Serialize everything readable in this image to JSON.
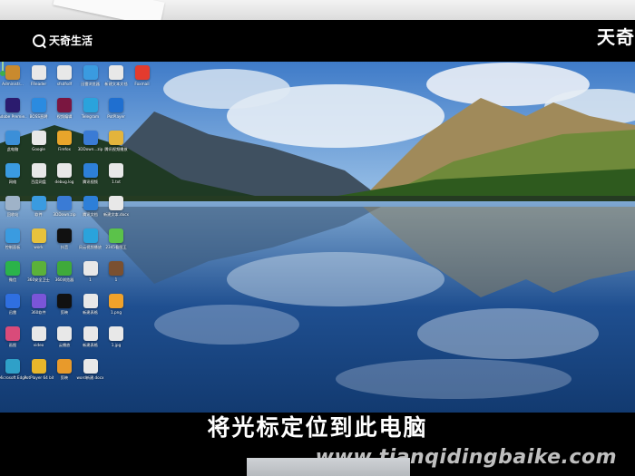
{
  "brand": {
    "left_logo_text": "天奇生活",
    "right_logo_text": "天奇"
  },
  "caption": "将光标定位到此电脑",
  "watermark": "www.tianqidingbaike.com",
  "desktop": {
    "icons": [
      {
        "label": "Administr...",
        "color": "#c98a2e",
        "icon": "user-folder-icon",
        "col": 0,
        "row": 0
      },
      {
        "label": "FReader",
        "color": "#e8e8e8",
        "icon": "file-icon",
        "col": 1,
        "row": 0
      },
      {
        "label": "sfsdfsdf",
        "color": "#e8e8e8",
        "icon": "file-icon",
        "col": 2,
        "row": 0
      },
      {
        "label": "迅雷浏览器",
        "color": "#3a9be0",
        "icon": "browser-icon",
        "col": 3,
        "row": 0
      },
      {
        "label": "新建文本文档",
        "color": "#e8e8e8",
        "icon": "text-file-icon",
        "col": 4,
        "row": 0
      },
      {
        "label": "Foxmail",
        "color": "#e33b2e",
        "icon": "foxmail-icon",
        "col": 5,
        "row": 0
      },
      {
        "label": "Adobe Premie...",
        "color": "#2b1b6e",
        "icon": "premiere-icon",
        "col": 0,
        "row": 1
      },
      {
        "label": "BOSS直聘",
        "color": "#2b8be0",
        "icon": "app-icon",
        "col": 1,
        "row": 1
      },
      {
        "label": "视频编辑",
        "color": "#7a1640",
        "icon": "video-icon",
        "col": 2,
        "row": 1
      },
      {
        "label": "Telegram",
        "color": "#2aa3dc",
        "icon": "telegram-icon",
        "col": 3,
        "row": 1
      },
      {
        "label": "PotPlayer",
        "color": "#1f6fd0",
        "icon": "player-icon",
        "col": 4,
        "row": 1
      },
      {
        "label": "此电脑",
        "color": "#3c8fd8",
        "icon": "computer-icon",
        "col": 0,
        "row": 2
      },
      {
        "label": "Google",
        "color": "#e8e8e8",
        "icon": "chrome-icon",
        "col": 1,
        "row": 2
      },
      {
        "label": "Firefox",
        "color": "#e8a52b",
        "icon": "folder-icon",
        "col": 2,
        "row": 2
      },
      {
        "label": "3DDown...zip",
        "color": "#3a7bd5",
        "icon": "archive-icon",
        "col": 3,
        "row": 2
      },
      {
        "label": "腾讯视频播放",
        "color": "#e3b43c",
        "icon": "folder-icon",
        "col": 4,
        "row": 2
      },
      {
        "label": "网络",
        "color": "#3a9be0",
        "icon": "network-icon",
        "col": 0,
        "row": 3
      },
      {
        "label": "百度网盘",
        "color": "#e8e8e8",
        "icon": "cloud-icon",
        "col": 1,
        "row": 3
      },
      {
        "label": "debug.log",
        "color": "#e8e8e8",
        "icon": "file-icon",
        "col": 2,
        "row": 3
      },
      {
        "label": "腾讯视频",
        "color": "#2d7fd8",
        "icon": "video-icon",
        "col": 3,
        "row": 3
      },
      {
        "label": "1.txt",
        "color": "#e8e8e8",
        "icon": "text-file-icon",
        "col": 4,
        "row": 3
      },
      {
        "label": "回收站",
        "color": "#9fb3c8",
        "icon": "recycle-bin-icon",
        "col": 0,
        "row": 4
      },
      {
        "label": "软件",
        "color": "#3a9be0",
        "icon": "app-icon",
        "col": 1,
        "row": 4
      },
      {
        "label": "3DDown.zip",
        "color": "#3a7bd5",
        "icon": "archive-icon",
        "col": 2,
        "row": 4
      },
      {
        "label": "腾讯文档",
        "color": "#2d7fd8",
        "icon": "doc-icon",
        "col": 3,
        "row": 4
      },
      {
        "label": "新建文本.docx",
        "color": "#e8e8e8",
        "icon": "word-icon",
        "col": 4,
        "row": 4
      },
      {
        "label": "控制面板",
        "color": "#3a9be0",
        "icon": "control-panel-icon",
        "col": 0,
        "row": 5
      },
      {
        "label": "work",
        "color": "#e8c23c",
        "icon": "folder-icon",
        "col": 1,
        "row": 5
      },
      {
        "label": "抖音",
        "color": "#111111",
        "icon": "tiktok-icon",
        "col": 2,
        "row": 5
      },
      {
        "label": "风云视频播放",
        "color": "#2aa3dc",
        "icon": "player-icon",
        "col": 3,
        "row": 5
      },
      {
        "label": "2345看图王",
        "color": "#5bc24a",
        "icon": "image-viewer-icon",
        "col": 4,
        "row": 5
      },
      {
        "label": "微信",
        "color": "#2bb34a",
        "icon": "wechat-icon",
        "col": 0,
        "row": 6
      },
      {
        "label": "360安全卫士",
        "color": "#5bb13a",
        "icon": "shield-icon",
        "col": 1,
        "row": 6
      },
      {
        "label": "360浏览器",
        "color": "#3faa3a",
        "icon": "browser-icon",
        "col": 2,
        "row": 6
      },
      {
        "label": "1",
        "color": "#e8e8e8",
        "icon": "file-icon",
        "col": 3,
        "row": 6
      },
      {
        "label": "1",
        "color": "#7a5030",
        "icon": "image-icon",
        "col": 4,
        "row": 6
      },
      {
        "label": "迅雷",
        "color": "#2f6fe0",
        "icon": "thunder-icon",
        "col": 0,
        "row": 7
      },
      {
        "label": "360软件",
        "color": "#7a55d8",
        "icon": "app-icon",
        "col": 1,
        "row": 7
      },
      {
        "label": "剪映",
        "color": "#111111",
        "icon": "capcut-icon",
        "col": 2,
        "row": 7
      },
      {
        "label": "新建表格",
        "color": "#e8e8e8",
        "icon": "excel-icon",
        "col": 3,
        "row": 7
      },
      {
        "label": "1.png",
        "color": "#f0a22b",
        "icon": "image-icon",
        "col": 4,
        "row": 7
      },
      {
        "label": "画图",
        "color": "#d94b7a",
        "icon": "paint-icon",
        "col": 0,
        "row": 8
      },
      {
        "label": "video",
        "color": "#e8e8e8",
        "icon": "file-icon",
        "col": 1,
        "row": 8
      },
      {
        "label": "云播放",
        "color": "#e8e8e8",
        "icon": "file-icon",
        "col": 2,
        "row": 8
      },
      {
        "label": "新建表格",
        "color": "#e8e8e8",
        "icon": "excel-icon",
        "col": 3,
        "row": 8
      },
      {
        "label": "1.jpg",
        "color": "#e8e8e8",
        "icon": "image-icon",
        "col": 4,
        "row": 8
      },
      {
        "label": "Microsoft Edge",
        "color": "#2fa0c8",
        "icon": "edge-icon",
        "col": 0,
        "row": 9
      },
      {
        "label": "PotPlayer 64 bit",
        "color": "#e8b62b",
        "icon": "player-icon",
        "col": 1,
        "row": 9
      },
      {
        "label": "剪映",
        "color": "#e89a2b",
        "icon": "capcut-icon",
        "col": 2,
        "row": 9
      },
      {
        "label": "word新建.docx",
        "color": "#e8e8e8",
        "icon": "word-icon",
        "col": 3,
        "row": 9
      }
    ]
  }
}
